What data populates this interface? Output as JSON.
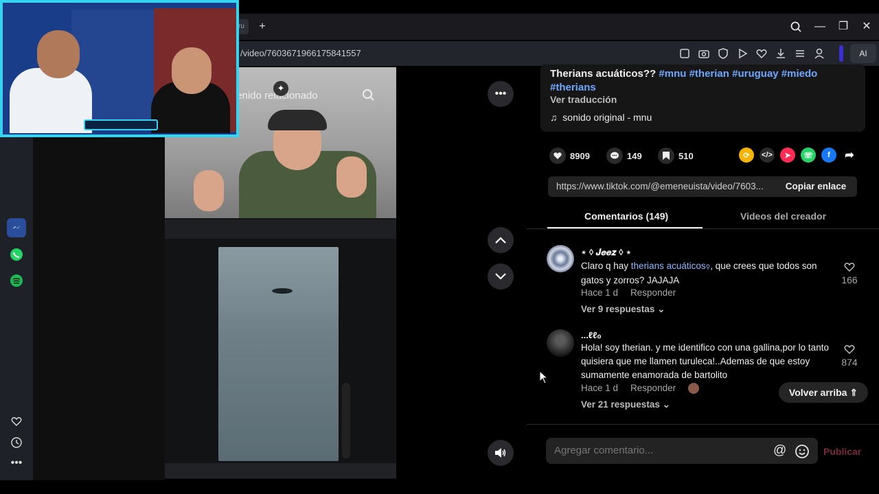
{
  "browser": {
    "tab_label": "ru",
    "url": "/video/7603671966175841557",
    "ai_label": "AI"
  },
  "video": {
    "search_placeholder": "tenido relacionado"
  },
  "post": {
    "title": "Therians acuáticos??",
    "hashtags": [
      "#mnu",
      "#therian",
      "#uruguay",
      "#miedo",
      "#therians"
    ],
    "translate_label": "Ver traducción",
    "sound": "sonido original - mnu",
    "likes": "8909",
    "comments": "149",
    "saves": "510",
    "link": "https://www.tiktok.com/@emeneuista/video/7603...",
    "copy_label": "Copiar enlace"
  },
  "tabs": {
    "comments": "Comentarios (149)",
    "creator": "Videos del creador"
  },
  "comments": [
    {
      "name": "⋆ ◊ 𝑱𝒆𝒆𝒛 ◊ ⋆",
      "text_before": "Claro q hay ",
      "link": "therians acuáticos",
      "text_after": ", que crees que todos son gatos y zorros? JAJAJA",
      "time": "Hace 1 d",
      "reply": "Responder",
      "replies": "Ver 9 respuestas",
      "likes": "166"
    },
    {
      "name": "...ℓℓℴ",
      "text": "Hola! soy therian. y me identifico con una gallina,por lo tanto quisiera que me llamen turuleca!..Ademas de que estoy sumamente enamorada de bartolito",
      "time": "Hace 1 d",
      "reply": "Responder",
      "replies": "Ver 21 respuestas",
      "likes": "874"
    }
  ],
  "back_to_top": "Volver arriba",
  "composer": {
    "placeholder": "Agregar comentario...",
    "publish": "Publicar"
  },
  "colors": {
    "accent_link": "#6fa8ff",
    "cam_border": "#36d4f0",
    "publish_disabled": "#7a2a3d"
  }
}
